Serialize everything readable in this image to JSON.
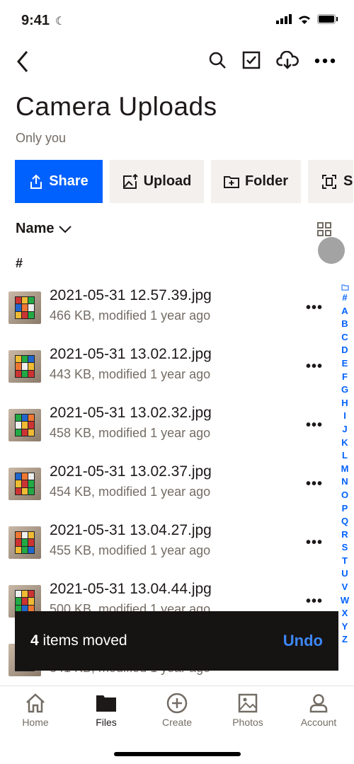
{
  "status": {
    "time": "9:41"
  },
  "header": {
    "title": "Camera Uploads",
    "subtitle": "Only you"
  },
  "actions": [
    {
      "label": "Share",
      "icon": "share-icon"
    },
    {
      "label": "Upload",
      "icon": "upload-photo-icon"
    },
    {
      "label": "Folder",
      "icon": "new-folder-icon"
    },
    {
      "label": "S",
      "icon": "scan-icon"
    }
  ],
  "sort": {
    "label": "Name"
  },
  "section": "#",
  "files": [
    {
      "name": "2021-05-31 12.57.39.jpg",
      "meta": "466 KB, modified 1 year ago"
    },
    {
      "name": "2021-05-31 13.02.12.jpg",
      "meta": "443 KB, modified 1 year ago"
    },
    {
      "name": "2021-05-31 13.02.32.jpg",
      "meta": "458 KB, modified 1 year ago"
    },
    {
      "name": "2021-05-31 13.02.37.jpg",
      "meta": "454 KB, modified 1 year ago"
    },
    {
      "name": "2021-05-31 13.04.27.jpg",
      "meta": "455 KB, modified 1 year ago"
    },
    {
      "name": "2021-05-31 13.04.44.jpg",
      "meta": "500 KB, modified 1 year ago"
    },
    {
      "name": "",
      "meta": "341 KB, modified 1 year ago"
    }
  ],
  "index": [
    "#",
    "A",
    "B",
    "C",
    "D",
    "E",
    "F",
    "G",
    "H",
    "I",
    "J",
    "K",
    "L",
    "M",
    "N",
    "O",
    "P",
    "Q",
    "R",
    "S",
    "T",
    "U",
    "V",
    "W",
    "X",
    "Y",
    "Z"
  ],
  "toast": {
    "count": "4",
    "message": " items moved",
    "action": "Undo"
  },
  "tabs": [
    {
      "label": "Home"
    },
    {
      "label": "Files",
      "active": true
    },
    {
      "label": "Create"
    },
    {
      "label": "Photos"
    },
    {
      "label": "Account"
    }
  ],
  "colors": {
    "accent": "#0061fe",
    "undo": "#3d87f5",
    "toast_bg": "#161313"
  }
}
